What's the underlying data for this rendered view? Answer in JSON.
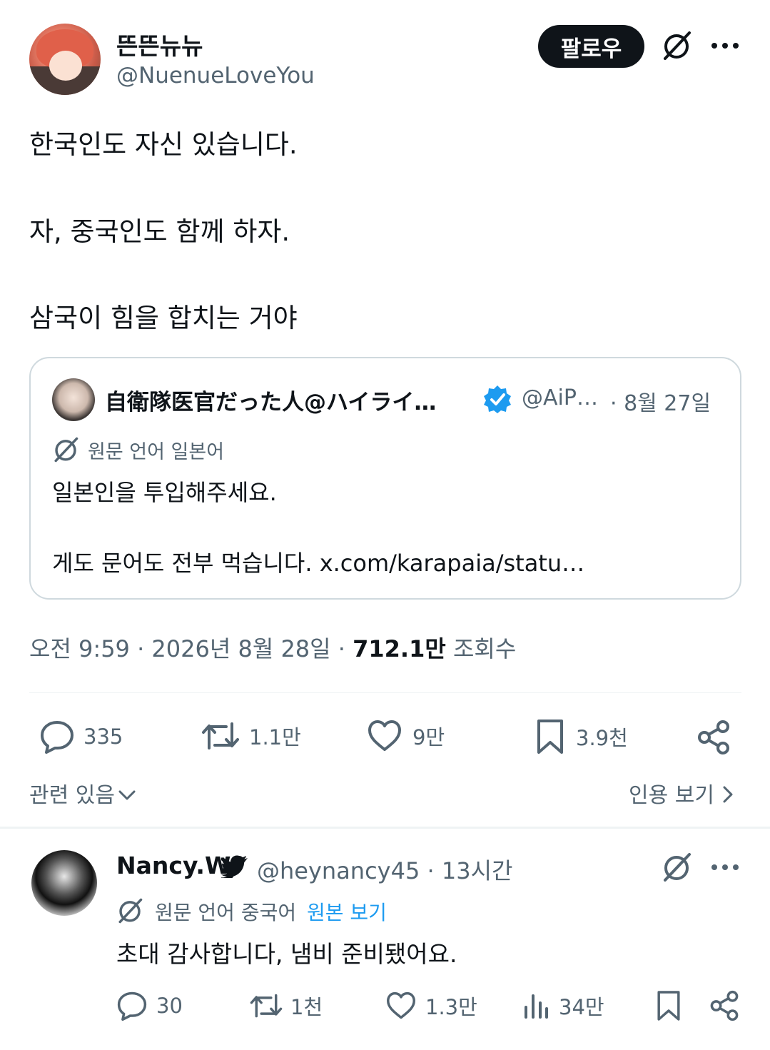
{
  "post": {
    "author_name": "뜬뜬뉴뉴",
    "author_handle": "@NuenueLoveYou",
    "follow_label": "팔로우",
    "text_lines": [
      "한국인도 자신 있습니다.",
      "자, 중국인도 함께 하자.",
      "삼국이 힘을 합치는 거야"
    ],
    "quote": {
      "author_name": "自衛隊医官だった人@ハイライ…",
      "author_handle": "@AiP…",
      "date": "· 8월 27일",
      "lang_note": "원문 언어 일본어",
      "line1": "일본인을 투입해주세요.",
      "line2": "게도 문어도 전부 먹습니다. x.com/karapaia/statu…"
    },
    "timestamp": "오전 9:59 · 2026년 8월 28일 · ",
    "views_count": "712.1만",
    "views_label": " 조회수",
    "actions": {
      "replies": "335",
      "reposts": "1.1만",
      "likes": "9만",
      "bookmarks": "3.9천"
    },
    "related_label": "관련 있음",
    "quotes_label": "인용 보기"
  },
  "reply": {
    "author_name": "Nancy.W",
    "author_handle": "@heynancy45 · 13시간",
    "lang_note": "원문 언어 중국어",
    "show_original": "원본 보기",
    "text": "초대 감사합니다, 냄비 준비됐어요.",
    "actions": {
      "replies": "30",
      "reposts": "1천",
      "likes": "1.3만",
      "views": "34만"
    }
  },
  "colors": {
    "text_primary": "#0f1419",
    "text_secondary": "#536471",
    "link": "#1d9bf0",
    "verified": "#1d9bf0",
    "border": "#cfd9de"
  }
}
